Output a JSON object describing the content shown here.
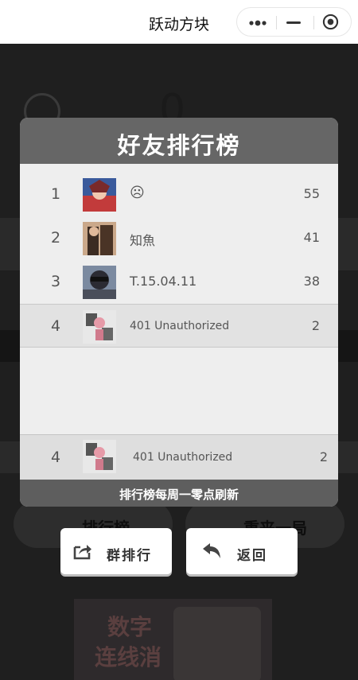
{
  "navbar": {
    "title": "跃动方块"
  },
  "background": {
    "score": "0",
    "buttons": [
      "排行榜",
      "重来一局"
    ],
    "ad": {
      "line1": "数字",
      "line2": "连线消"
    }
  },
  "modal": {
    "title": "好友排行榜",
    "rows": [
      {
        "rank": "1",
        "name": "☹",
        "score": "55"
      },
      {
        "rank": "2",
        "name": "知魚",
        "score": "41"
      },
      {
        "rank": "3",
        "name": "T.15.04.11",
        "score": "38"
      },
      {
        "rank": "4",
        "name": "401 Unauthorized",
        "score": "2"
      }
    ],
    "my_rank": {
      "rank": "4",
      "name": "401 Unauthorized",
      "score": "2"
    },
    "footer": "排行榜每周一零点刷新"
  },
  "actions": {
    "group_rank": "群排行",
    "back": "返回"
  },
  "colors": {
    "header": "#666666",
    "panel": "#eeeeee",
    "footer": "#5e5e5e"
  }
}
